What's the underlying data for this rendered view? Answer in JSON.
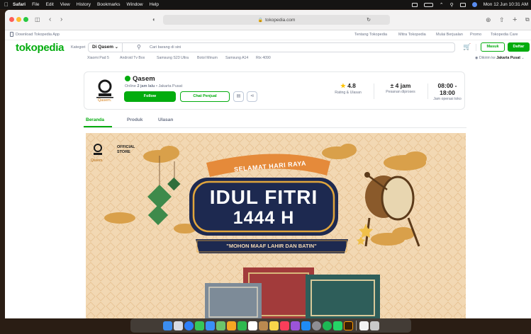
{
  "menubar": {
    "apple": "",
    "app": "Safari",
    "items": [
      "File",
      "Edit",
      "View",
      "History",
      "Bookmarks",
      "Window",
      "Help"
    ],
    "datetime": "Mon 12 Jun  10:31 AM"
  },
  "browser": {
    "url": "tokopedia.com",
    "lock_icon": "lock-icon"
  },
  "topstrip": {
    "download": "Download Tokopedia App",
    "links": [
      "Tentang Tokopedia",
      "Mitra Tokopedia",
      "Mulai Berjualan",
      "Promo",
      "Tokopedia Care"
    ]
  },
  "header": {
    "logo": "tokopedia",
    "kategori": "Kategori",
    "search_location": "Di Qasem",
    "search_placeholder": "Cari barang di sini",
    "masuk": "Masuk",
    "daftar": "Daftar"
  },
  "keywords": [
    "Xiaomi Pad 5",
    "Android Tv Box",
    "Samsung S23 Ultra",
    "Botol Minum",
    "Samsung A14",
    "Rtx 4090"
  ],
  "delivery": {
    "prefix": "Dikirim ke",
    "location": "Jakarta Pusat"
  },
  "shop": {
    "logo_text": "Qasem.",
    "name": "Qasem",
    "status_prefix": "Online",
    "status_time": "2 jam lalu",
    "status_location": " • Jakarta Pusat",
    "follow": "Follow",
    "chat": "Chat Penjual",
    "stats": [
      {
        "value": "4.8",
        "label": "Rating & Ulasan"
      },
      {
        "value": "± 4 jam",
        "label": "Pesanan diproses"
      },
      {
        "value": "08:00 - 18:00",
        "label": "Jam operasi toko"
      }
    ]
  },
  "tabs": [
    "Beranda",
    "Produk",
    "Ulasan"
  ],
  "banner": {
    "official_line1": "OFFICIAL",
    "official_line2": "STORE",
    "logo_text": "Qasem.",
    "greeting": "SELAMAT HARI RAYA",
    "headline1": "IDUL FITRI",
    "headline2": "1444 H",
    "subline": "\"MOHON MAAF LAHIR DAN BATIN\""
  },
  "colors": {
    "brand": "#03ac0e",
    "banner_bg": "#f2d8b3",
    "banner_navy": "#1d2950",
    "banner_gold": "#e0a53c",
    "ribbon": "#e58a3a"
  }
}
